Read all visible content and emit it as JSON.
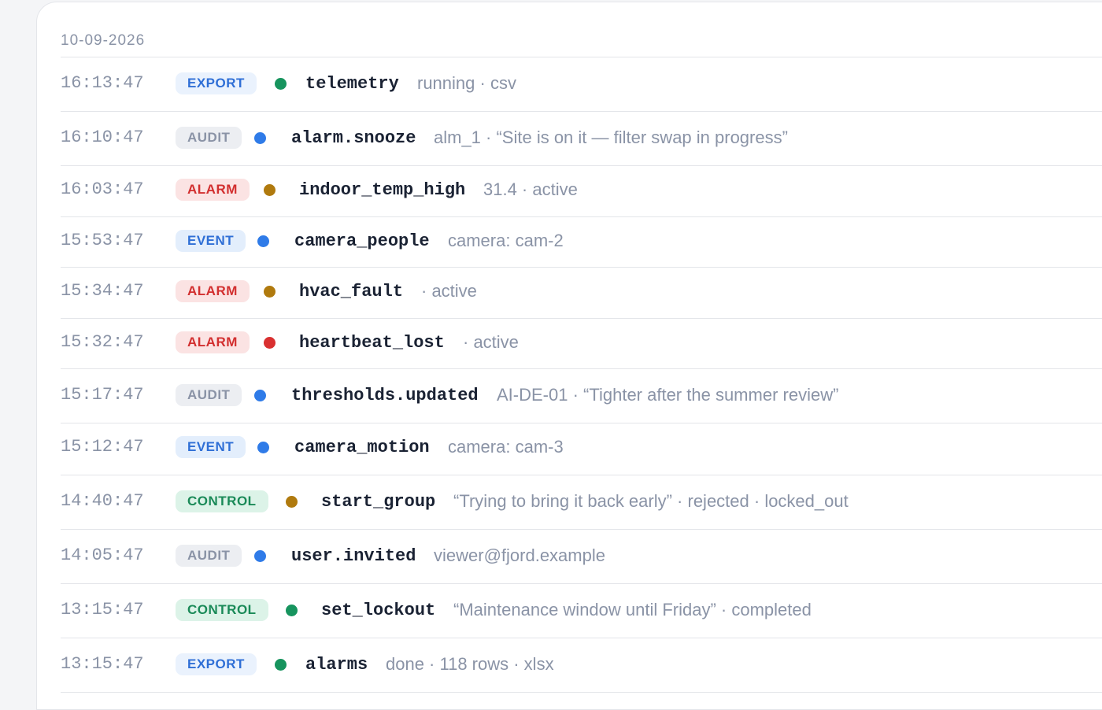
{
  "log": {
    "date": "10-09-2026",
    "entries": [
      {
        "time": "16:13:47",
        "category": "EXPORT",
        "status_color": "#17945e",
        "name": "telemetry",
        "detail": "running · csv"
      },
      {
        "time": "16:10:47",
        "category": "AUDIT",
        "status_color": "#2f7be8",
        "name": "alarm.snooze",
        "detail": "alm_1 · “Site is on it — filter swap in progress”"
      },
      {
        "time": "16:03:47",
        "category": "ALARM",
        "status_color": "#b07a0e",
        "name": "indoor_temp_high",
        "detail": "31.4 · active"
      },
      {
        "time": "15:53:47",
        "category": "EVENT",
        "status_color": "#2f7be8",
        "name": "camera_people",
        "detail": "camera: cam-2"
      },
      {
        "time": "15:34:47",
        "category": "ALARM",
        "status_color": "#b07a0e",
        "name": "hvac_fault",
        "detail": "· active"
      },
      {
        "time": "15:32:47",
        "category": "ALARM",
        "status_color": "#d93030",
        "name": "heartbeat_lost",
        "detail": "· active"
      },
      {
        "time": "15:17:47",
        "category": "AUDIT",
        "status_color": "#2f7be8",
        "name": "thresholds.updated",
        "detail": "AI-DE-01 · “Tighter after the summer review”"
      },
      {
        "time": "15:12:47",
        "category": "EVENT",
        "status_color": "#2f7be8",
        "name": "camera_motion",
        "detail": "camera: cam-3"
      },
      {
        "time": "14:40:47",
        "category": "CONTROL",
        "status_color": "#b07a0e",
        "name": "start_group",
        "detail": "“Trying to bring it back early” · rejected · locked_out"
      },
      {
        "time": "14:05:47",
        "category": "AUDIT",
        "status_color": "#2f7be8",
        "name": "user.invited",
        "detail": "viewer@fjord.example"
      },
      {
        "time": "13:15:47",
        "category": "CONTROL",
        "status_color": "#17945e",
        "name": "set_lockout",
        "detail": "“Maintenance window until Friday” · completed"
      },
      {
        "time": "13:15:47",
        "category": "EXPORT",
        "status_color": "#17945e",
        "name": "alarms",
        "detail": "done · 118 rows · xlsx"
      }
    ]
  }
}
